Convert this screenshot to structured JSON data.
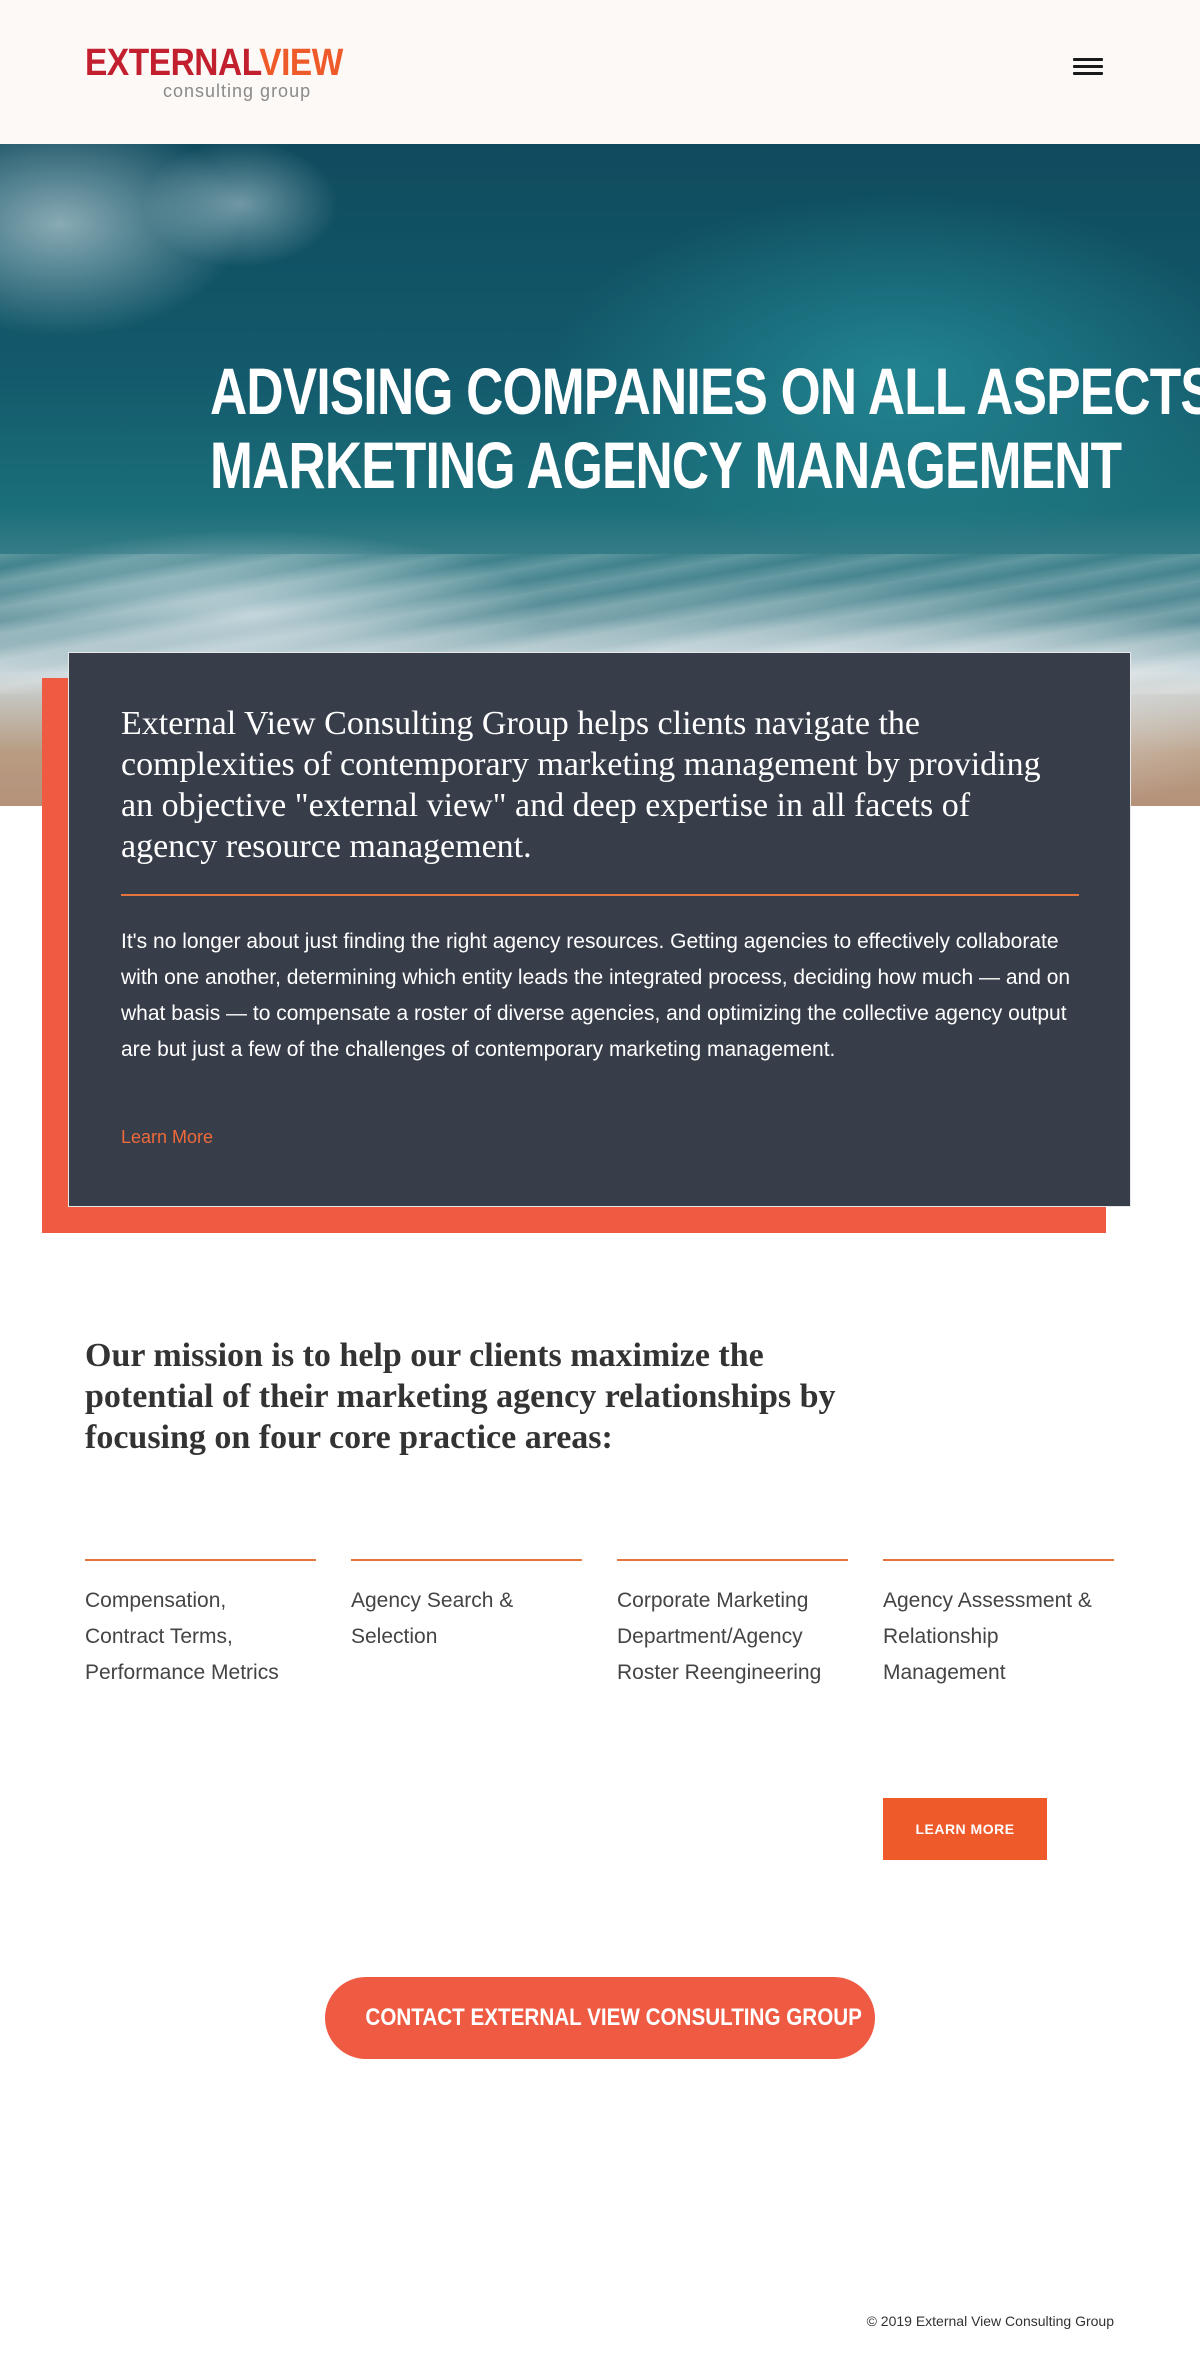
{
  "header": {
    "logo": {
      "word1": "EXTERNAL",
      "word2": "VIEW",
      "tagline": "consulting group"
    },
    "menu_icon": "hamburger-icon"
  },
  "hero": {
    "title_line1": "ADVISING COMPANIES ON ALL ASPECTS OF",
    "title_line2": "MARKETING AGENCY MANAGEMENT"
  },
  "intro": {
    "lead": "External View Consulting Group helps clients navigate the complexities of contemporary marketing management by providing an objective \"external view\" and deep expertise in all facets of agency resource management.",
    "body": "It's no longer about just finding the right agency resources. Getting agencies to effectively collaborate with one another, determining which entity leads the integrated process, deciding how much — and on what basis — to compensate a roster of diverse agencies, and optimizing the collective agency output are but just a few of the challenges of contemporary marketing management.",
    "link_label": "Learn More"
  },
  "mission": {
    "text": "Our mission is to help our clients maximize the potential of their marketing agency relationships by focusing on four core practice areas:",
    "areas": [
      "Compensation, Contract Terms, Performance Metrics",
      "Agency Search & Selection",
      "Corporate Marketing Department/Agency Roster Reengineering",
      "Agency Assessment & Relationship Management"
    ],
    "button_label": "LEARN MORE"
  },
  "contact": {
    "button_label": "CONTACT EXTERNAL VIEW CONSULTING GROUP"
  },
  "footer": {
    "copyright": "© 2019 External View Consulting Group"
  },
  "colors": {
    "brand_red": "#c2202f",
    "brand_orange": "#ef5a2b",
    "accent_coral": "#ef5a43",
    "card_bg": "#373d49"
  }
}
